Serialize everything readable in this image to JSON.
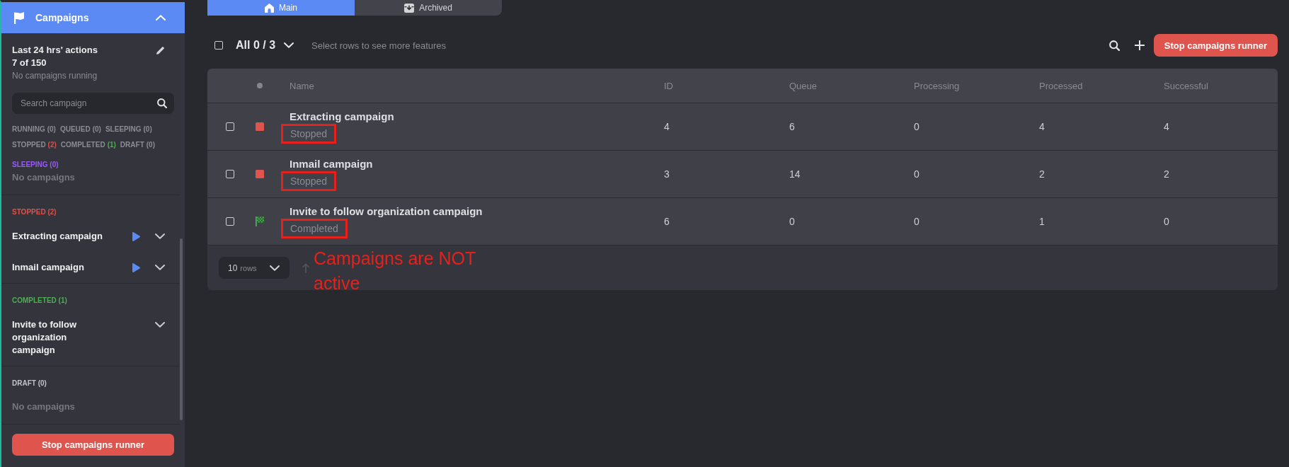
{
  "sidebar": {
    "header": {
      "title": "Campaigns",
      "expanded": true
    },
    "usage": {
      "title": "Last 24 hrs' actions",
      "count": "7 of 150",
      "status": "No campaigns running"
    },
    "search": {
      "placeholder": "Search campaign"
    },
    "filters": [
      {
        "label": "RUNNING",
        "count": "(0)",
        "color": "#8c8d94"
      },
      {
        "label": "QUEUED",
        "count": "(0)",
        "color": "#8c8d94"
      },
      {
        "label": "SLEEPING",
        "count": "(0)",
        "color": "#8c8d94"
      },
      {
        "label": "STOPPED",
        "count": "(2)",
        "color": "#e0504a"
      },
      {
        "label": "COMPLETED",
        "count": "(1)",
        "color": "#4caf50"
      },
      {
        "label": "DRAFT",
        "count": "(0)",
        "color": "#8c8d94"
      }
    ],
    "groups": [
      {
        "title": "SLEEPING (0)",
        "color": "#9b5cf6",
        "empty_text": "No campaigns"
      },
      {
        "title": "STOPPED (2)",
        "color": "#e0504a",
        "campaigns": [
          {
            "name": "Extracting campaign",
            "can_start": true,
            "expanded": false
          },
          {
            "name": "Inmail campaign",
            "can_start": true,
            "expanded": false
          }
        ]
      },
      {
        "title": "COMPLETED (1)",
        "color": "#4caf50",
        "campaigns": [
          {
            "name": "Invite to follow organization campaign",
            "can_start": false,
            "expanded": false
          }
        ]
      },
      {
        "title": "DRAFT (0)",
        "color": "#c4c5ca",
        "empty_text": "No campaigns"
      }
    ],
    "button": "Stop campaigns runner"
  },
  "tabs": [
    {
      "label": "Main",
      "selected": true
    },
    {
      "label": "Archived",
      "selected": false
    }
  ],
  "toolbar": {
    "select_all_checked": false,
    "selection": "All 0 / 3",
    "hint": "Select rows to see more features",
    "button": "Stop campaigns runner"
  },
  "table": {
    "columns": [
      "Name",
      "ID",
      "Queue",
      "Processing",
      "Processed",
      "Successful"
    ],
    "rows": [
      {
        "checked": false,
        "kind": "stopped",
        "name": "Extracting campaign",
        "status": "Stopped",
        "status_highlighted": true,
        "values": [
          "4",
          "6",
          "0",
          "4",
          "4"
        ]
      },
      {
        "checked": false,
        "kind": "stopped",
        "name": "Inmail campaign",
        "status": "Stopped",
        "status_highlighted": true,
        "values": [
          "3",
          "14",
          "0",
          "2",
          "2"
        ]
      },
      {
        "checked": false,
        "kind": "completed",
        "name": "Invite to follow organization campaign",
        "status": "Completed",
        "status_highlighted": true,
        "values": [
          "6",
          "0",
          "0",
          "1",
          "0"
        ]
      }
    ],
    "page_size": {
      "value": "10",
      "unit": "rows"
    }
  },
  "annotation": {
    "text": "Campaigns are NOT active"
  }
}
